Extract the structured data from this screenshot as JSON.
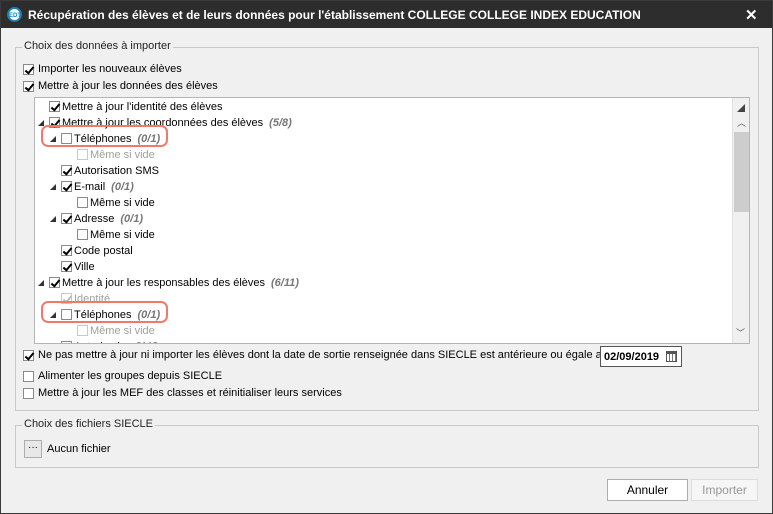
{
  "window": {
    "title": "Récupération des élèves et de leurs données pour l'établissement COLLEGE COLLEGE INDEX EDUCATION",
    "logo": "EDT",
    "close": "✕"
  },
  "data_group": {
    "legend": "Choix des données à importer",
    "import_new": {
      "label": "Importer les nouveaux élèves",
      "checked": true
    },
    "update_data": {
      "label": "Mettre à jour les données des élèves",
      "checked": true
    },
    "tree": [
      {
        "label": "Mettre à jour l'identité des élèves",
        "checked": true,
        "level": 1
      },
      {
        "label": "Mettre à jour les coordonnées des élèves",
        "count": "(5/8)",
        "checked": true,
        "level": 1,
        "expander": true
      },
      {
        "label": "Téléphones",
        "count": "(0/1)",
        "checked": false,
        "level": 2,
        "expander": true,
        "highlighted": true
      },
      {
        "label": "Même si vide",
        "checked": false,
        "level": 3,
        "disabled": true
      },
      {
        "label": "Autorisation SMS",
        "checked": true,
        "level": 2
      },
      {
        "label": "E-mail",
        "count": "(0/1)",
        "checked": true,
        "level": 2,
        "expander": true
      },
      {
        "label": "Même si vide",
        "checked": false,
        "level": 3
      },
      {
        "label": "Adresse",
        "count": "(0/1)",
        "checked": true,
        "level": 2,
        "expander": true
      },
      {
        "label": "Même si vide",
        "checked": false,
        "level": 3
      },
      {
        "label": "Code postal",
        "checked": true,
        "level": 2
      },
      {
        "label": "Ville",
        "checked": true,
        "level": 2
      },
      {
        "label": "Mettre à jour les responsables des élèves",
        "count": "(6/11)",
        "checked": true,
        "level": 1,
        "expander": true
      },
      {
        "label": "Identité",
        "checked": true,
        "level": 2,
        "disabled": true
      },
      {
        "label": "Téléphones",
        "count": "(0/1)",
        "checked": false,
        "level": 2,
        "expander": true,
        "highlighted": true
      },
      {
        "label": "Même si vide",
        "checked": false,
        "level": 3,
        "disabled": true
      },
      {
        "label": "Autorisation SMS",
        "checked": false,
        "level": 2
      }
    ],
    "exclude_left": {
      "label": "Ne pas mettre à jour ni importer les élèves dont la date de sortie renseignée dans SIECLE est antérieure ou égale au",
      "checked": true,
      "date": "02/09/2019"
    },
    "groups": {
      "label": "Alimenter les groupes depuis SIECLE",
      "checked": false
    },
    "mef": {
      "label": "Mettre à jour les MEF des classes et réinitialiser leurs services",
      "checked": false
    }
  },
  "files_group": {
    "legend": "Choix des fichiers SIECLE",
    "browse": "···",
    "file": "Aucun fichier"
  },
  "buttons": {
    "cancel": "Annuler",
    "import": "Importer"
  },
  "colors": {
    "highlight": "#f07a6a",
    "titlebar": "#2d2d2d"
  }
}
